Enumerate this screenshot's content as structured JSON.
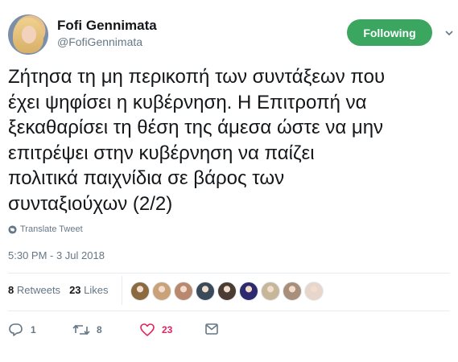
{
  "author": {
    "name": "Fofi Gennimata",
    "handle": "@FofiGennimata"
  },
  "follow_button": {
    "label": "Following",
    "color": "#3aa660"
  },
  "tweet": {
    "text": "Ζήτησα τη μη περικοπή των συντάξεων που\nέχει ψηφίσει η κυβέρνηση. Η Επιτροπή να\nξεκαθαρίσει τη θέση της άμεσα ώστε να μην\nεπιτρέψει στην κυβέρνηση να παίζει\nπολιτικά παιχνίδια σε βάρος των\nσυνταξιούχων (2/2)",
    "translate_label": "Translate Tweet",
    "timestamp": "5:30 PM - 3 Jul 2018"
  },
  "stats": {
    "retweets_count": "8",
    "retweets_label": "Retweets",
    "likes_count": "23",
    "likes_label": "Likes"
  },
  "liker_avatars": [
    {
      "color": "#8b6a3f"
    },
    {
      "color": "#c9a27a"
    },
    {
      "color": "#b8896f"
    },
    {
      "color": "#3b4a5a"
    },
    {
      "color": "#4a3b33"
    },
    {
      "color": "#2d2a6e"
    },
    {
      "color": "#c7b79a"
    },
    {
      "color": "#a88f7c"
    },
    {
      "color": "#e6d6cc"
    }
  ],
  "actions": {
    "reply_count": "1",
    "retweet_count": "8",
    "like_count": "23",
    "like_color": "#e0245e",
    "icons": [
      "reply-icon",
      "retweet-icon",
      "heart-icon",
      "message-icon"
    ]
  },
  "colors": {
    "text": "#14171a",
    "secondary": "#657786",
    "divider": "#e6ecf0"
  }
}
